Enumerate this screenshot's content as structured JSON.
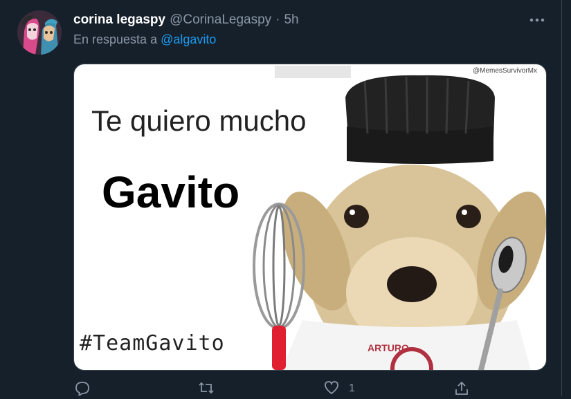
{
  "tweet": {
    "display_name": "corina legaspy",
    "handle": "@CorinaLegaspy",
    "separator": "·",
    "time": "5h",
    "reply_prefix": "En respuesta a",
    "reply_mention": "@algavito"
  },
  "media": {
    "line1": "Te quiero mucho",
    "line2": "Gavito",
    "hashtag": "#TeamGavito",
    "watermark": "@MemesSurvivorMx",
    "apron_text": "ARTURO"
  },
  "actions": {
    "like_count": "1"
  },
  "colors": {
    "background": "#15202b",
    "link": "#1d9bf0",
    "muted": "#8b98a5",
    "border": "#38444d"
  },
  "icons": [
    "more-icon",
    "reply-icon",
    "retweet-icon",
    "like-icon",
    "share-icon"
  ]
}
